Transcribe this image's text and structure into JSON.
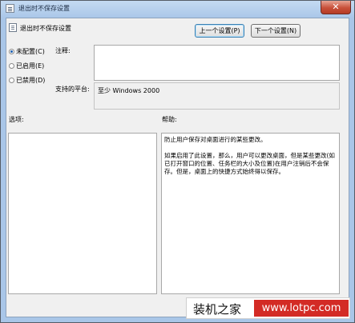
{
  "window": {
    "title": "退出时不保存设置",
    "close_glyph": "✕"
  },
  "header": {
    "setting_name": "退出时不保存设置",
    "prev_button": "上一个设置(P)",
    "next_button": "下一个设置(N)"
  },
  "state": {
    "options": [
      {
        "label": "未配置(C)",
        "selected": true
      },
      {
        "label": "已启用(E)",
        "selected": false
      },
      {
        "label": "已禁用(D)",
        "selected": false
      }
    ]
  },
  "comment": {
    "label": "注释:",
    "value": ""
  },
  "supported": {
    "label": "支持的平台:",
    "value": "至少 Windows 2000"
  },
  "options_panel": {
    "label": "选项:"
  },
  "help_panel": {
    "label": "帮助:",
    "text": "防止用户保存对桌面进行的某些更改。\n\n如果启用了此设置，那么，用户可以更改桌面，但是某些更改(如已打开窗口的位置、任务栏的大小及位置)在用户注销后不会保存。但是，桌面上的快捷方式始终得以保存。"
  },
  "watermark": {
    "site_name": "装机之家",
    "url": "www.lotpc.com"
  }
}
